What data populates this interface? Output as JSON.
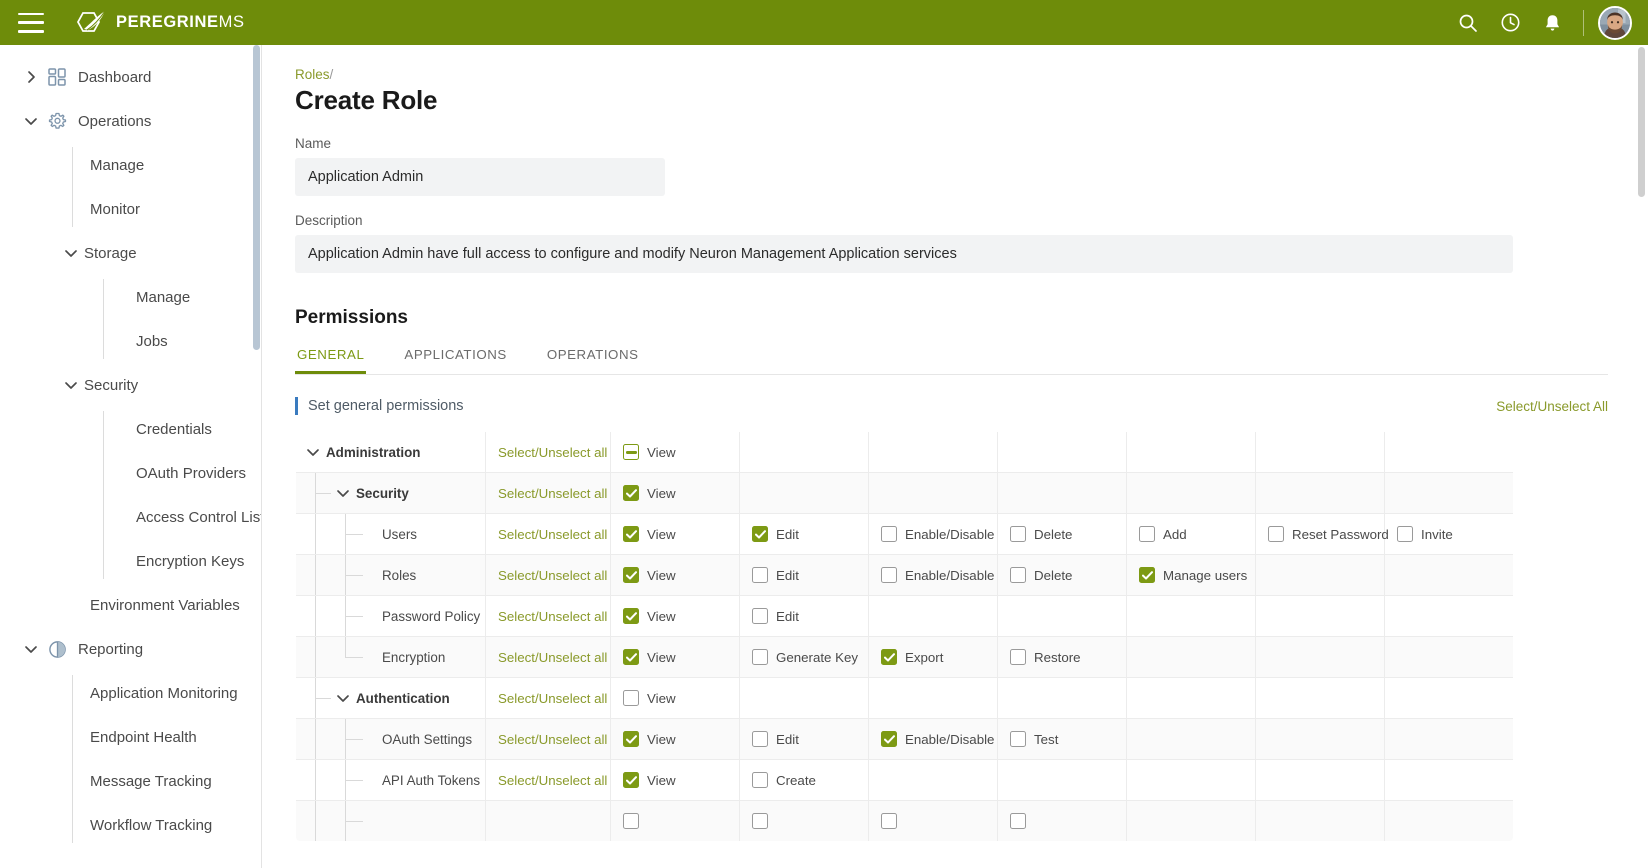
{
  "topbar": {
    "menu_icon": "hamburger-icon",
    "brand_bold": "PEREGRINE",
    "brand_light": "MS",
    "search_icon": "search-icon",
    "history_icon": "clock-history-icon",
    "notifications_icon": "bell-icon",
    "avatar_name": "user-avatar"
  },
  "sidebar": {
    "items": [
      {
        "label": "Dashboard",
        "level": 1,
        "icon": "dashboard-grid-icon",
        "chevron": "right",
        "name": "dashboard"
      },
      {
        "label": "Operations",
        "level": 1,
        "icon": "gear-icon",
        "chevron": "down",
        "name": "operations"
      },
      {
        "label": "Manage",
        "level": 2,
        "icon": "",
        "chevron": "none",
        "name": "operations-manage"
      },
      {
        "label": "Monitor",
        "level": 2,
        "icon": "",
        "chevron": "none",
        "name": "operations-monitor"
      },
      {
        "label": "Storage",
        "level": 2,
        "icon": "",
        "chevron": "down",
        "name": "storage"
      },
      {
        "label": "Manage",
        "level": 3,
        "icon": "",
        "chevron": "none",
        "name": "storage-manage"
      },
      {
        "label": "Jobs",
        "level": 3,
        "icon": "",
        "chevron": "none",
        "name": "storage-jobs"
      },
      {
        "label": "Security",
        "level": 2,
        "icon": "",
        "chevron": "down",
        "name": "security"
      },
      {
        "label": "Credentials",
        "level": 3,
        "icon": "",
        "chevron": "none",
        "name": "security-credentials"
      },
      {
        "label": "OAuth Providers",
        "level": 3,
        "icon": "",
        "chevron": "none",
        "name": "security-oauth-providers"
      },
      {
        "label": "Access Control Lists",
        "level": 3,
        "icon": "",
        "chevron": "none",
        "name": "security-access-control-lists"
      },
      {
        "label": "Encryption Keys",
        "level": 3,
        "icon": "",
        "chevron": "none",
        "name": "security-encryption-keys"
      },
      {
        "label": "Environment Variables",
        "level": 2,
        "icon": "",
        "chevron": "none",
        "name": "environment-variables"
      },
      {
        "label": "Reporting",
        "level": 1,
        "icon": "pie-chart-icon",
        "chevron": "down",
        "name": "reporting"
      },
      {
        "label": "Application Monitoring",
        "level": 2,
        "icon": "",
        "chevron": "none",
        "name": "reporting-application-monitoring"
      },
      {
        "label": "Endpoint Health",
        "level": 2,
        "icon": "",
        "chevron": "none",
        "name": "reporting-endpoint-health"
      },
      {
        "label": "Message Tracking",
        "level": 2,
        "icon": "",
        "chevron": "none",
        "name": "reporting-message-tracking"
      },
      {
        "label": "Workflow Tracking",
        "level": 2,
        "icon": "",
        "chevron": "none",
        "name": "reporting-workflow-tracking"
      }
    ]
  },
  "breadcrumb": {
    "parent": "Roles",
    "separator": "/"
  },
  "page_title": "Create Role",
  "form": {
    "name_label": "Name",
    "name_value": "Application Admin",
    "name_placeholder": "Name",
    "description_label": "Description",
    "description_value": "Application Admin have full access to configure and modify Neuron Management Application services",
    "description_placeholder": "Description"
  },
  "permissions": {
    "title": "Permissions",
    "tabs": [
      {
        "label": "General",
        "active": true
      },
      {
        "label": "Applications",
        "active": false
      },
      {
        "label": "Operations",
        "active": false
      }
    ],
    "subhead": "Set general permissions",
    "select_all_link": "Select/Unselect All",
    "select_row_link": "Select/Unselect all",
    "rows": [
      {
        "name": "Administration",
        "level": 0,
        "bold": true,
        "chevron": "down",
        "shade": false,
        "perms": [
          {
            "label": "View",
            "state": "indeterminate"
          }
        ]
      },
      {
        "name": "Security",
        "level": 1,
        "bold": true,
        "chevron": "down",
        "shade": true,
        "perms": [
          {
            "label": "View",
            "state": "checked"
          }
        ]
      },
      {
        "name": "Users",
        "level": 2,
        "bold": false,
        "chevron": "none",
        "shade": false,
        "perms": [
          {
            "label": "View",
            "state": "checked"
          },
          {
            "label": "Edit",
            "state": "checked"
          },
          {
            "label": "Enable/Disable",
            "state": "unchecked"
          },
          {
            "label": "Delete",
            "state": "unchecked"
          },
          {
            "label": "Add",
            "state": "unchecked"
          },
          {
            "label": "Reset Password",
            "state": "unchecked"
          },
          {
            "label": "Invite",
            "state": "unchecked"
          }
        ]
      },
      {
        "name": "Roles",
        "level": 2,
        "bold": false,
        "chevron": "none",
        "shade": true,
        "perms": [
          {
            "label": "View",
            "state": "checked"
          },
          {
            "label": "Edit",
            "state": "unchecked"
          },
          {
            "label": "Enable/Disable",
            "state": "unchecked"
          },
          {
            "label": "Delete",
            "state": "unchecked"
          },
          {
            "label": "Manage users",
            "state": "checked"
          }
        ]
      },
      {
        "name": "Password Policy",
        "level": 2,
        "bold": false,
        "chevron": "none",
        "shade": false,
        "perms": [
          {
            "label": "View",
            "state": "checked"
          },
          {
            "label": "Edit",
            "state": "unchecked"
          }
        ]
      },
      {
        "name": "Encryption",
        "level": 2,
        "bold": false,
        "chevron": "none",
        "shade": true,
        "last_child": true,
        "perms": [
          {
            "label": "View",
            "state": "checked"
          },
          {
            "label": "Generate Key",
            "state": "unchecked"
          },
          {
            "label": "Export",
            "state": "checked"
          },
          {
            "label": "Restore",
            "state": "unchecked"
          }
        ]
      },
      {
        "name": "Authentication",
        "level": 1,
        "bold": true,
        "chevron": "down",
        "shade": false,
        "perms": [
          {
            "label": "View",
            "state": "unchecked"
          }
        ]
      },
      {
        "name": "OAuth Settings",
        "level": 2,
        "bold": false,
        "chevron": "none",
        "shade": true,
        "perms": [
          {
            "label": "View",
            "state": "checked"
          },
          {
            "label": "Edit",
            "state": "unchecked"
          },
          {
            "label": "Enable/Disable",
            "state": "checked"
          },
          {
            "label": "Test",
            "state": "unchecked"
          }
        ]
      },
      {
        "name": "API Auth Tokens",
        "level": 2,
        "bold": false,
        "chevron": "none",
        "shade": false,
        "perms": [
          {
            "label": "View",
            "state": "checked"
          },
          {
            "label": "Create",
            "state": "unchecked"
          }
        ]
      },
      {
        "name": "",
        "level": 2,
        "bold": false,
        "chevron": "none",
        "shade": true,
        "partial": true,
        "perms": [
          {
            "label": "",
            "state": "unchecked"
          },
          {
            "label": "",
            "state": "unchecked"
          },
          {
            "label": "",
            "state": "unchecked"
          },
          {
            "label": "",
            "state": "unchecked"
          }
        ]
      }
    ],
    "column_count": 8
  },
  "colors": {
    "brand_green": "#6e8c0a",
    "link_green": "#8a9a2b",
    "checkbox_green": "#7d9a14",
    "accent_blue": "#3a7bbf",
    "input_bg": "#f2f3f4"
  }
}
